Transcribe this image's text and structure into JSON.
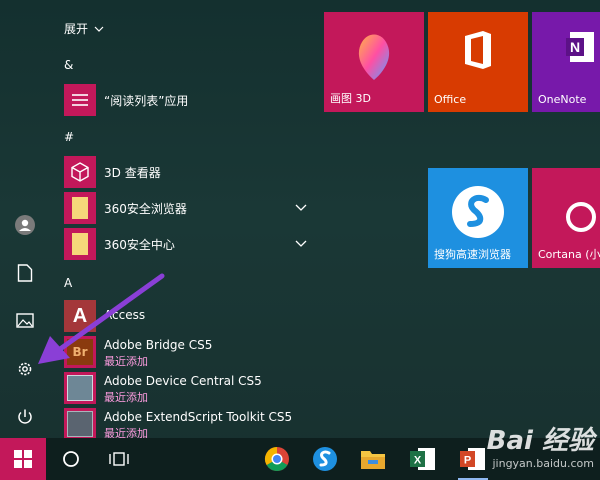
{
  "app_list": {
    "expand_label": "展开",
    "section_amp": "&",
    "section_hash": "#",
    "section_a": "A",
    "apps": [
      {
        "name": "“阅读列表”应用",
        "icon": "reading-list-icon",
        "color": "#c3185a"
      },
      {
        "name": "3D 查看器",
        "icon": "3d-viewer-icon",
        "color": "#c3185a"
      },
      {
        "name": "360安全浏览器",
        "icon": "folder-icon",
        "color": "#c3185a"
      },
      {
        "name": "360安全中心",
        "icon": "folder-icon",
        "color": "#c3185a"
      },
      {
        "name": "Access",
        "icon": "access-icon",
        "color": "#a4373a"
      },
      {
        "name": "Adobe Bridge CS5",
        "sub": "最近添加",
        "icon": "bridge-icon",
        "color": "#c3185a"
      },
      {
        "name": "Adobe Device Central CS5",
        "sub": "最近添加",
        "icon": "device-central-icon",
        "color": "#c3185a"
      },
      {
        "name": "Adobe ExtendScript Toolkit CS5",
        "sub": "最近添加",
        "icon": "extendscript-icon",
        "color": "#c3185a"
      }
    ]
  },
  "tiles": [
    {
      "label": "画图 3D",
      "color": "#c3185a"
    },
    {
      "label": "Office",
      "color": "#d83b01"
    },
    {
      "label": "OneNote",
      "color": "#7719aa"
    },
    {
      "label": "搜狗高速浏览器",
      "color": "#1e90e0"
    },
    {
      "label": "Cortana (小",
      "color": "#c3185a"
    }
  ],
  "watermark": {
    "brand": "Bai 经验",
    "url": "jingyan.baidu.com"
  },
  "colors": {
    "accent": "#c3185a",
    "taskbar": "#0e1f1e",
    "arrow": "#8a3fd6"
  }
}
